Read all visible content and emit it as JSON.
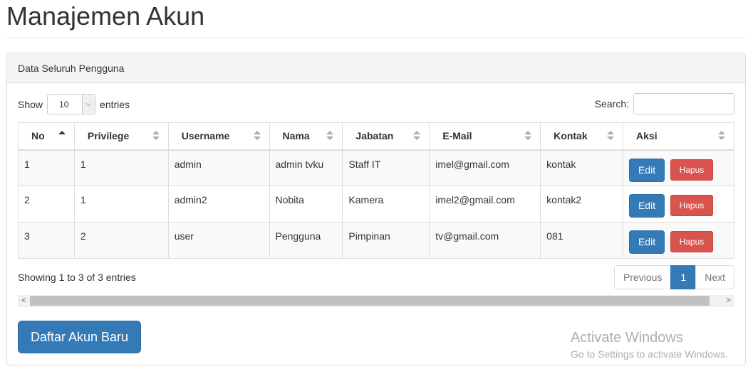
{
  "page": {
    "title": "Manajemen Akun"
  },
  "panel": {
    "heading": "Data Seluruh Pengguna"
  },
  "length_control": {
    "show_label": "Show",
    "value": "10",
    "entries_label": "entries"
  },
  "search": {
    "label": "Search:",
    "value": ""
  },
  "table": {
    "columns": [
      "No",
      "Privilege",
      "Username",
      "Nama",
      "Jabatan",
      "E-Mail",
      "Kontak",
      "Aksi"
    ],
    "rows": [
      [
        "1",
        "1",
        "admin",
        "admin tvku",
        "Staff IT",
        "imel@gmail.com",
        "kontak"
      ],
      [
        "2",
        "1",
        "admin2",
        "Nobita",
        "Kamera",
        "imel2@gmail.com",
        "kontak2"
      ],
      [
        "3",
        "2",
        "user",
        "Pengguna",
        "Pimpinan",
        "tv@gmail.com",
        "081"
      ]
    ],
    "edit_label": "Edit",
    "delete_label": "Hapus"
  },
  "info": "Showing 1 to 3 of 3 entries",
  "pagination": {
    "previous": "Previous",
    "current": "1",
    "next": "Next"
  },
  "scrollbar": {
    "left_arrow": "<",
    "right_arrow": ">"
  },
  "register_button": "Daftar Akun Baru",
  "watermark": {
    "line1": "Activate Windows",
    "line2": "Go to Settings to activate Windows."
  },
  "colors": {
    "primary": "#337ab7",
    "danger": "#d9534f"
  }
}
